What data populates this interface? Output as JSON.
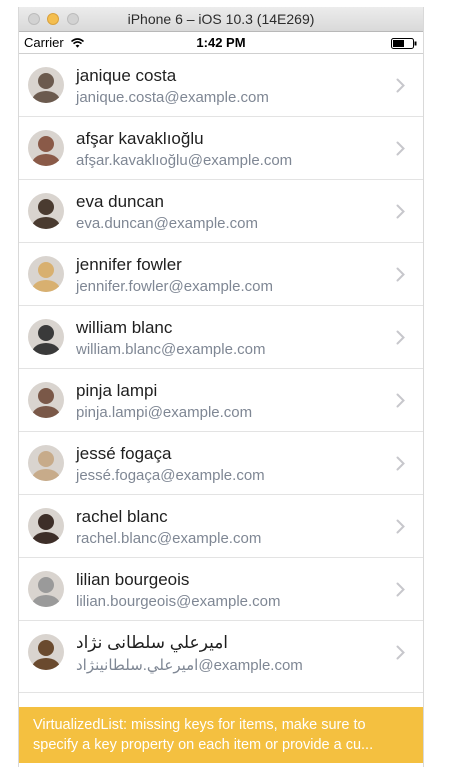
{
  "window": {
    "title": "iPhone 6 – iOS 10.3 (14E269)"
  },
  "status_bar": {
    "carrier": "Carrier",
    "time": "1:42 PM"
  },
  "contacts": [
    {
      "name": "janique costa",
      "email": "janique.costa@example.com",
      "avatar_color": "#6b5a4e"
    },
    {
      "name": "afşar kavaklıoğlu",
      "email": "afşar.kavaklıoğlu@example.com",
      "avatar_color": "#8a5a48"
    },
    {
      "name": "eva duncan",
      "email": "eva.duncan@example.com",
      "avatar_color": "#4a3b30"
    },
    {
      "name": "jennifer fowler",
      "email": "jennifer.fowler@example.com",
      "avatar_color": "#d8b070"
    },
    {
      "name": "william blanc",
      "email": "william.blanc@example.com",
      "avatar_color": "#3a3a3a"
    },
    {
      "name": "pinja lampi",
      "email": "pinja.lampi@example.com",
      "avatar_color": "#7a5848"
    },
    {
      "name": "jessé fogaça",
      "email": "jessé.fogaça@example.com",
      "avatar_color": "#c7ab8a"
    },
    {
      "name": "rachel blanc",
      "email": "rachel.blanc@example.com",
      "avatar_color": "#3d2e28"
    },
    {
      "name": "lilian bourgeois",
      "email": "lilian.bourgeois@example.com",
      "avatar_color": "#9a9a9a"
    },
    {
      "name": "اميرعلي سلطانی نژاد",
      "email": "اميرعلي.سلطانینژاد@example.com",
      "avatar_color": "#6a4a2e"
    }
  ],
  "warning": {
    "line1": "VirtualizedList: missing keys for items, make sure to",
    "line2": "specify a key property on each item or provide a cu..."
  },
  "colors": {
    "warning_bg": "#f4c040",
    "email_text": "#7f8794",
    "chevron": "#c7c7cc"
  }
}
